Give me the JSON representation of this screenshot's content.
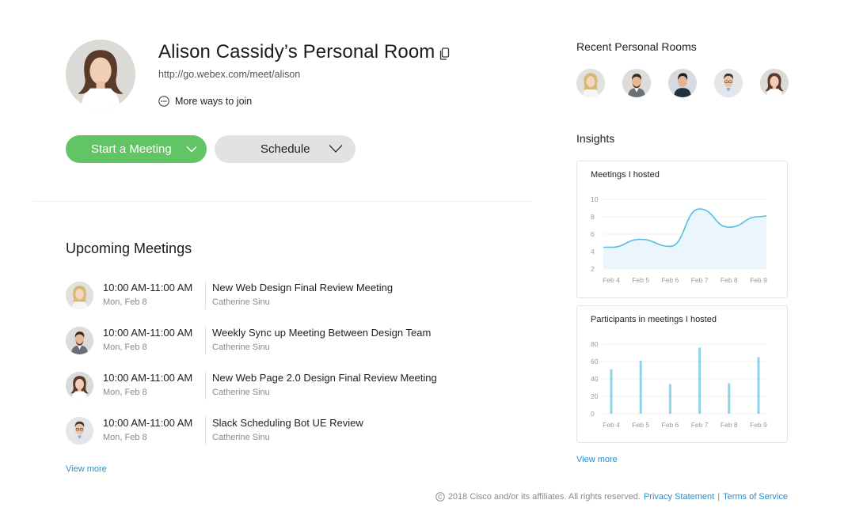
{
  "room": {
    "title": "Alison Cassidy’s Personal Room",
    "url": "http://go.webex.com/meet/alison",
    "more_ways": "More ways to join"
  },
  "buttons": {
    "start": "Start a Meeting",
    "schedule": "Schedule"
  },
  "upcoming": {
    "title": "Upcoming Meetings",
    "meetings": [
      {
        "time": "10:00 AM-11:00 AM",
        "date": "Mon, Feb 8",
        "title": "New Web Design Final Review Meeting",
        "host": "Catherine Sinu"
      },
      {
        "time": "10:00 AM-11:00 AM",
        "date": "Mon, Feb 8",
        "title": "Weekly Sync up Meeting Between Design Team",
        "host": "Catherine Sinu"
      },
      {
        "time": "10:00 AM-11:00 AM",
        "date": "Mon, Feb 8",
        "title": "New Web Page 2.0 Design Final Review Meeting",
        "host": "Catherine Sinu"
      },
      {
        "time": "10:00 AM-11:00 AM",
        "date": "Mon, Feb 8",
        "title": "Slack Scheduling Bot UE Review",
        "host": "Catherine Sinu"
      }
    ],
    "view_more": "View more"
  },
  "recent": {
    "title": "Recent Personal Rooms"
  },
  "insights": {
    "title": "Insights",
    "view_more": "View more"
  },
  "chart_data": [
    {
      "type": "area",
      "title": "Meetings I hosted",
      "categories": [
        "Feb 4",
        "Feb 5",
        "Feb 6",
        "Feb 7",
        "Feb 8",
        "Feb 9"
      ],
      "values": [
        4.5,
        5.4,
        4.6,
        8.9,
        6.8,
        8.0
      ],
      "yticks": [
        2,
        4,
        6,
        8,
        10
      ],
      "ylim": [
        2,
        10
      ],
      "color": "#55bde3"
    },
    {
      "type": "bar",
      "title": "Participants in meetings I hosted",
      "categories": [
        "Feb 4",
        "Feb 5",
        "Feb 6",
        "Feb 7",
        "Feb 8",
        "Feb 9"
      ],
      "values": [
        51,
        61,
        34,
        76,
        35,
        65
      ],
      "yticks": [
        0,
        20,
        40,
        60,
        80
      ],
      "ylim": [
        0,
        80
      ],
      "color": "#8fd3ea"
    }
  ],
  "footer": {
    "copyright": "2018 Cisco and/or its affiliates. All rights reserved.",
    "privacy": "Privacy Statement",
    "separator": "|",
    "terms": "Terms of Service"
  },
  "colors": {
    "start_button": "#63c465",
    "schedule_button": "#e2e2e2",
    "link": "#2a8ec8"
  }
}
